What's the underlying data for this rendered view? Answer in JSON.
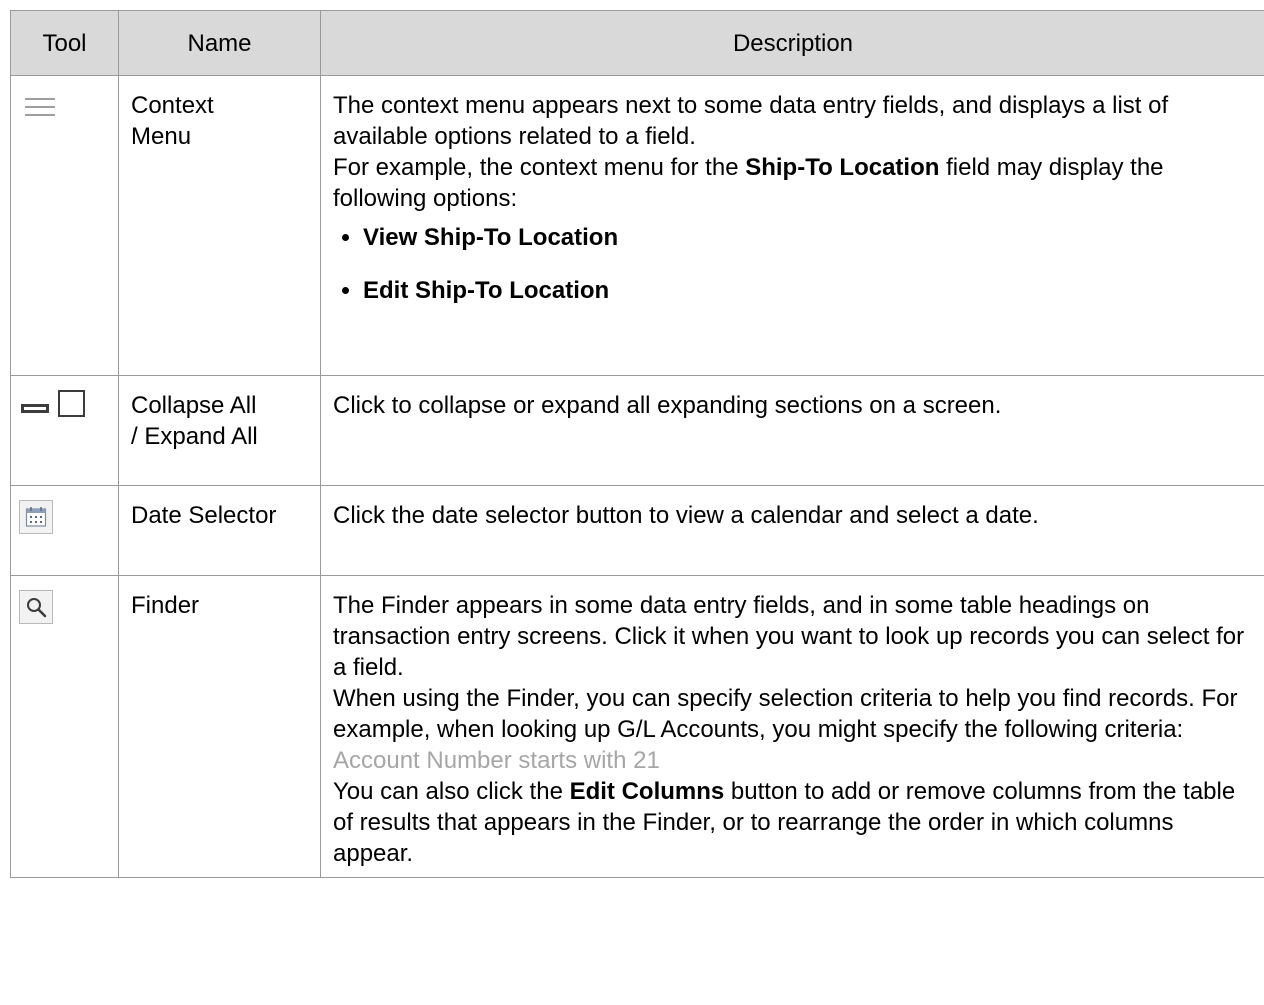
{
  "headers": {
    "tool": "Tool",
    "name": "Name",
    "description": "Description"
  },
  "rows": [
    {
      "icon": "context-menu-icon",
      "name_lines": [
        "Context",
        "Menu"
      ],
      "desc_p1": "The context menu appears next to some data entry fields, and displays a list of available options related to a field.",
      "desc_p2_pre": "For example, the context menu for the ",
      "desc_p2_bold": "Ship-To Location",
      "desc_p2_post": " field may display the following options:",
      "bullets": [
        "View Ship-To Location",
        "Edit Ship-To Location"
      ]
    },
    {
      "icon": "collapse-expand-icon",
      "name_lines": [
        "Collapse All",
        "/ Expand All"
      ],
      "desc_p1": "Click to collapse or expand all expanding sections on a screen."
    },
    {
      "icon": "calendar-icon",
      "name_lines": [
        "Date Selector"
      ],
      "desc_p1": "Click the date selector button to view a calendar and select a date."
    },
    {
      "icon": "magnifier-icon",
      "name_lines": [
        "Finder"
      ],
      "desc_p1": "The Finder appears in some data entry fields, and in some table headings on transaction entry screens. Click it when you want to look up records you can select for a field.",
      "desc_p2": "When using the Finder, you can specify selection criteria to help you find records. For example, when looking up G/L Accounts, you might specify the following criteria:",
      "desc_example": "Account Number starts with 21",
      "desc_p3_pre": "You can also click the ",
      "desc_p3_bold": "Edit Columns",
      "desc_p3_post": " button to add or remove columns from the table of results that appears in the Finder, or to rearrange the order in which columns appear."
    }
  ]
}
